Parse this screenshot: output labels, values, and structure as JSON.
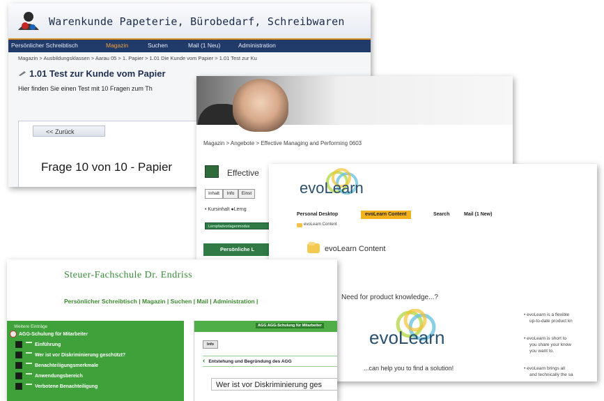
{
  "card_papeterie": {
    "title": "Warenkunde Papeterie, Bürobedarf, Schreibwaren",
    "nav": [
      "Persönlicher Schreibtisch",
      "Magazin",
      "Suchen",
      "Mail (1 Neu)",
      "Administration"
    ],
    "breadcrumb": "Magazin > Ausbildungsklassen > Aarau 05 > 1. Papier > 1.01 Die Kunde vom Papier > 1.01 Test zur Ku",
    "heading": "1.01 Test zur Kunde vom Papier",
    "description": "Hier finden Sie einen Test mit 10 Fragen zum Th",
    "back_label": "<< Zurück",
    "question": "Frage 10 von 10 - Papier"
  },
  "card_managing": {
    "breadcrumb": "Magazin > Angebote > Effective Managing and Performing 0603",
    "heading": "Effective",
    "tabs": [
      "Inhalt",
      "Info",
      "Einst"
    ],
    "options": "• Kursinhalt  ●Lerng",
    "green_label": "Lernpfadvorlagenmodus",
    "section": "Persönliche L"
  },
  "card_evolearn": {
    "logo_text": "evoLearn",
    "nav": [
      "Personal Desktop",
      "evoLearn Content",
      "Search",
      "Mail (1 New)"
    ],
    "active_nav": "evoLearn Content",
    "crumb": "evoLearn Content",
    "heading": "evoLearn Content",
    "need": "Need for product knowledge...?",
    "logo_text_2": "evoLearn",
    "help": "...can help you to find a solution!",
    "bullets": [
      [
        "• evoLearn is a flexible",
        "up-to-date product kn"
      ],
      [
        "• evoLearn is short to",
        "you share your know",
        "you want to."
      ],
      [
        "• evoLearn brings all",
        "and technically the sa"
      ]
    ]
  },
  "card_steuer": {
    "brand": "Steuer-Fachschule Dr. Endriss",
    "nav": "Persönlicher Schreibtisch | Magazin | Suchen | Mail | Administration |",
    "side_heading": "Weitere Einträge",
    "side_items": [
      "AGG-Schulung für Mitarbeiter",
      "Einführung",
      "Wer ist vor Diskriminierung geschützt?",
      "Benachteiligungsmerkmale",
      "Anwendungsbereich",
      "Verbotene Benachteiligung"
    ],
    "topbar": "AGG  AGG-Schulung für Mitarbeiter",
    "info": "Info",
    "section": "Entstehung und Begründung des AGG",
    "question": "Wer ist vor Diskriminierung ges"
  },
  "colors": {
    "nav_blue": "#203a6a",
    "accent_orange": "#f3b21c",
    "steuer_green": "#3fa13a"
  }
}
